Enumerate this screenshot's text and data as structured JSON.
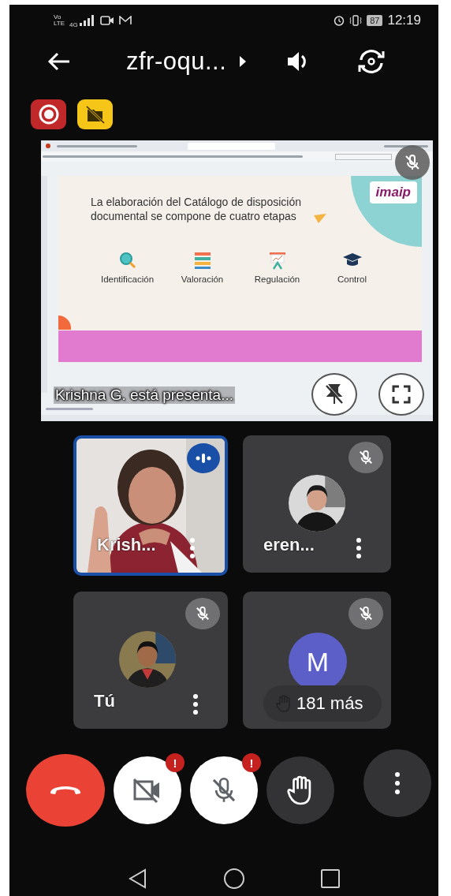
{
  "status_bar": {
    "volte": "Vo",
    "lte": "LTE",
    "network": "4G",
    "battery": "87",
    "time": "12:19"
  },
  "header": {
    "title": "zfr-oqu..."
  },
  "presentation": {
    "slide": {
      "title": "La elaboración del Catálogo de disposición documental se compone de cuatro etapas",
      "logo": "imaip",
      "stages": [
        {
          "label": "Identificación",
          "kind": "magnifier"
        },
        {
          "label": "Valoración",
          "kind": "books"
        },
        {
          "label": "Regulación",
          "kind": "easel"
        },
        {
          "label": "Control",
          "kind": "cap"
        }
      ]
    },
    "caption": "Krishna G. está presenta...",
    "muted": true
  },
  "participants": [
    {
      "name": "Krish...",
      "kind": "video",
      "speaking": true,
      "muted": false
    },
    {
      "name": "eren...",
      "speaking": false,
      "muted": true
    },
    {
      "name": "Tú",
      "speaking": false,
      "muted": true
    },
    {
      "initial": "M",
      "kind": "letter",
      "speaking": false,
      "muted": true,
      "more": "181 más"
    }
  ],
  "controls": [
    {
      "kind": "hangup"
    },
    {
      "kind": "camera",
      "badge": "!"
    },
    {
      "kind": "mic",
      "badge": "!"
    },
    {
      "kind": "hand"
    },
    {
      "kind": "more"
    }
  ]
}
